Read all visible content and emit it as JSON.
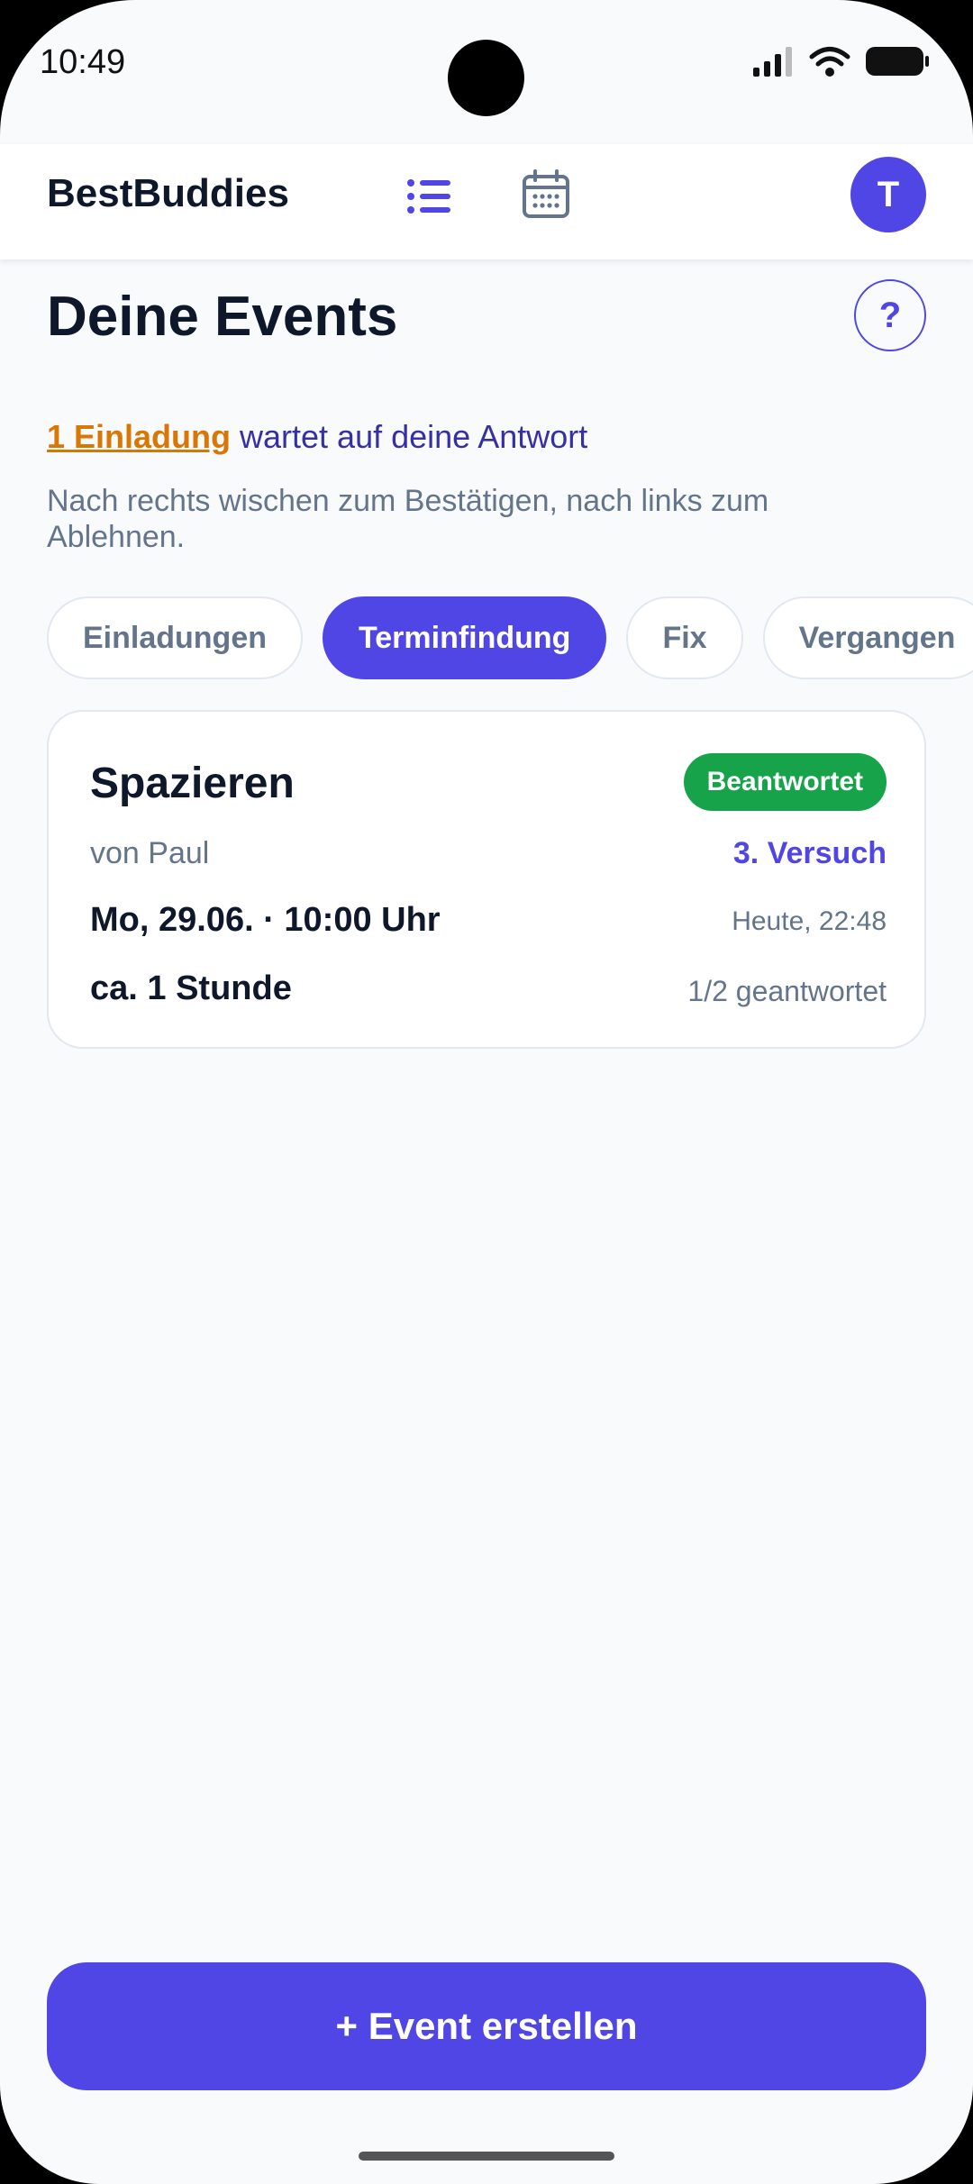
{
  "status_bar": {
    "time": "10:49"
  },
  "header": {
    "brand": "BestBuddies",
    "list_icon": "list-icon",
    "calendar_icon": "calendar-icon",
    "avatar_initial": "T"
  },
  "main": {
    "title": "Deine Events",
    "help_label": "?",
    "invite": {
      "link_text": "1 Einladung",
      "rest_text": " wartet auf deine Antwort"
    },
    "hint": "Nach rechts wischen zum Bestätigen, nach links zum Ablehnen.",
    "tabs": [
      {
        "label": "Einladungen",
        "active": false
      },
      {
        "label": "Terminfindung",
        "active": true
      },
      {
        "label": "Fix",
        "active": false
      },
      {
        "label": "Vergangen",
        "active": false
      }
    ],
    "events": [
      {
        "title": "Spazieren",
        "status": "Beantwortet",
        "owner": "von Paul",
        "attempt": "3. Versuch",
        "date": "Mo, 29.06. · 10:00 Uhr",
        "updated": "Heute, 22:48",
        "duration": "ca. 1 Stunde",
        "answered": "1/2 geantwortet"
      }
    ]
  },
  "footer": {
    "create_label": "+ Event erstellen"
  },
  "colors": {
    "primary": "#4f46e5",
    "warning": "#d97706",
    "success": "#16a34a",
    "background": "#f8fafc"
  }
}
